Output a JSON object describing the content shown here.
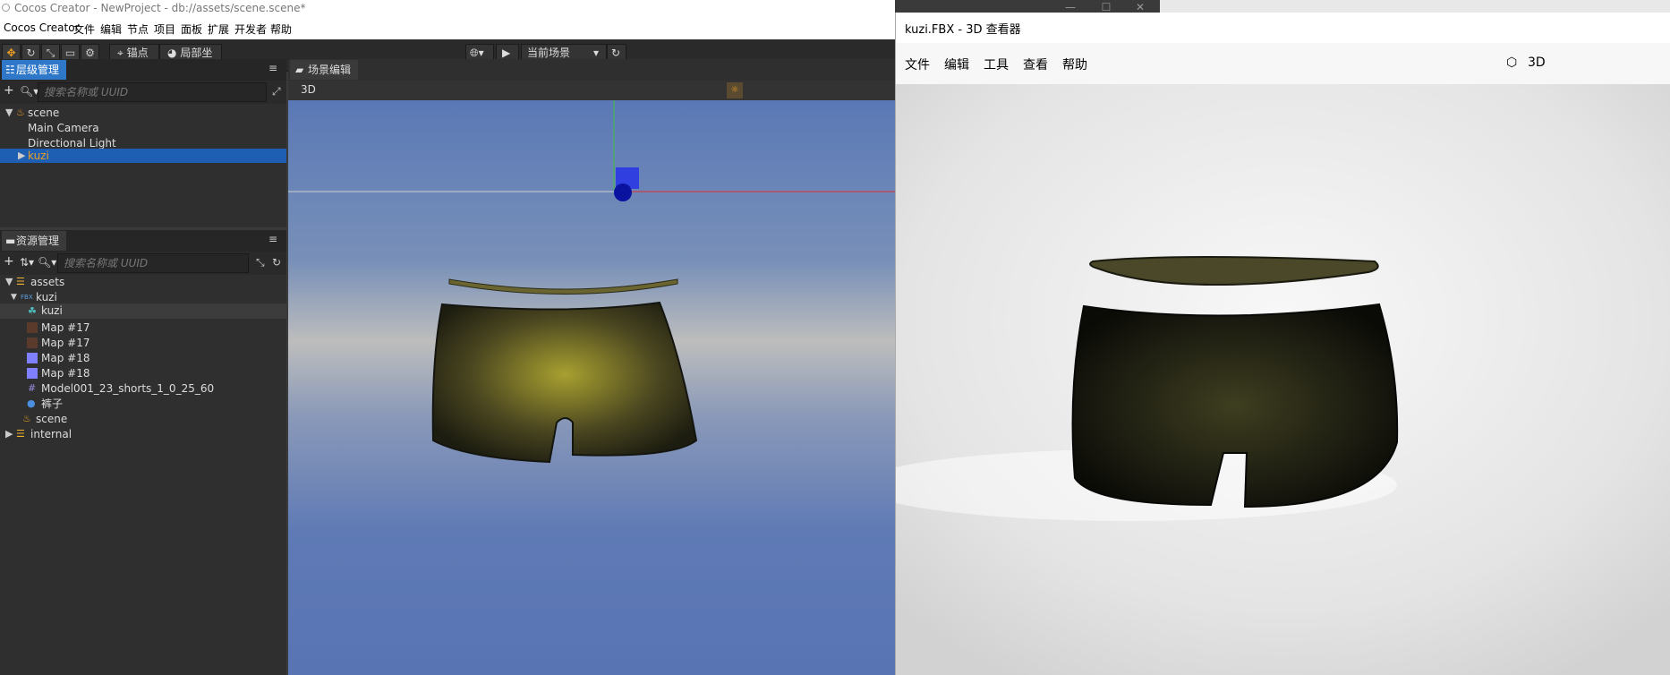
{
  "window": {
    "title": "Cocos Creator - NewProject - db://assets/scene.scene*"
  },
  "menu": [
    "Cocos Creator",
    "文件",
    "编辑",
    "节点",
    "项目",
    "面板",
    "扩展",
    "开发者",
    "帮助"
  ],
  "toolbar": {
    "pivot_label": "锚点",
    "local_label": "局部坐标",
    "scene_select": "当前场景"
  },
  "hierarchy": {
    "tab_label": "层级管理器",
    "search_placeholder": "搜索名称或 UUID",
    "items": [
      "scene",
      "Main Camera",
      "Directional Light",
      "kuzi"
    ]
  },
  "scene_editor": {
    "tab_label": "场景编辑器",
    "mode_label": "3D"
  },
  "assets": {
    "tab_label": "资源管理器",
    "search_placeholder": "搜索名称或 UUID",
    "items": [
      "assets",
      "kuzi",
      "kuzi",
      "Map #17",
      "Map #17",
      "Map #18",
      "Map #18",
      "Model001_23_shorts_1_0_25_60",
      "裤子",
      "scene",
      "internal"
    ],
    "fbx_badge": "FBX"
  },
  "viewer": {
    "title": "kuzi.FBX - 3D 查看器",
    "menu": [
      "文件",
      "编辑",
      "工具",
      "查看",
      "帮助"
    ],
    "right_label": "3D"
  },
  "colors": {
    "accent": "#f0a020",
    "selection": "#1e5fb4",
    "scene_bg": "#5a7ab8",
    "viewer_bg": "#ececec"
  }
}
